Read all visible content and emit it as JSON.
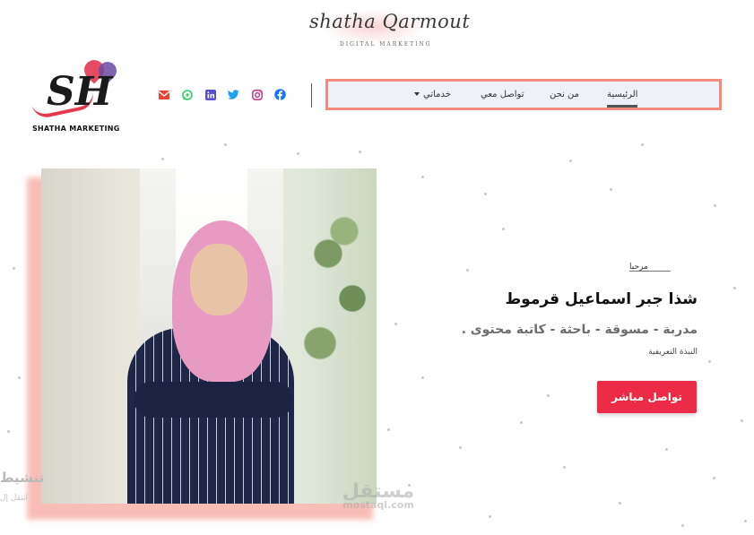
{
  "top_logo": {
    "script": "shatha Qarmout",
    "subtitle": "DIGITAL MARKETING"
  },
  "brand": {
    "monogram": "SH",
    "name": "SHATHA MARKETING"
  },
  "socials": [
    {
      "icon": "facebook-icon",
      "color": "#1877f2"
    },
    {
      "icon": "instagram-icon",
      "color": "#c13584"
    },
    {
      "icon": "twitter-icon",
      "color": "#1da1f2"
    },
    {
      "icon": "linkedin-icon",
      "color": "#0a66c2"
    },
    {
      "icon": "whatsapp-icon",
      "color": "#25d366"
    },
    {
      "icon": "email-icon",
      "color": "#ea4335"
    }
  ],
  "nav": {
    "items": [
      {
        "label": "الرئيسية",
        "active": true
      },
      {
        "label": "من نحن"
      },
      {
        "label": "تواصل معي"
      },
      {
        "label": "خدماتي",
        "dropdown": true
      }
    ]
  },
  "hero": {
    "greeting": "مرحبا",
    "name": "شذا جبر اسماعيل قرموط",
    "roles": "مدربة - مسوقة - باحثة - كاتبة محتوى .",
    "bio_label": "النبذة التعريفية",
    "cta": "تواصل مباشر"
  },
  "side_peek": {
    "line1": "تنشيط",
    "line2": "انتقل إل"
  },
  "watermark": {
    "arabic": "مستقل",
    "latin": "mostaql.com"
  },
  "colors": {
    "accent": "#ec2b46",
    "nav_border": "#f28b7b",
    "nav_bg": "#eef1f7"
  }
}
